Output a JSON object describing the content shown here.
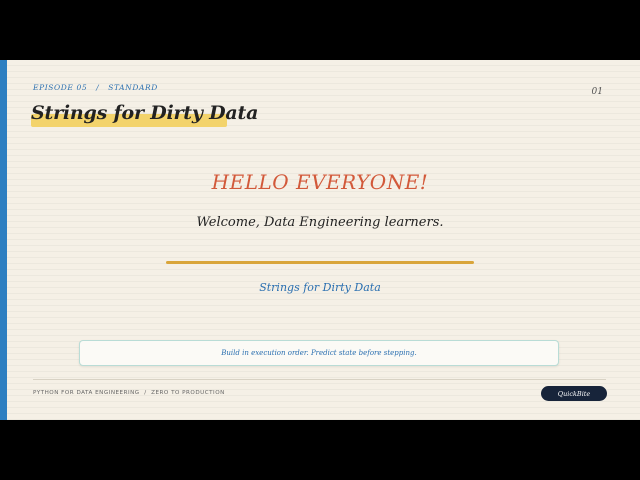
{
  "header": {
    "episode": "EPISODE 05",
    "separator": "/",
    "level": "STANDARD",
    "page_number": "01",
    "title": "Strings for Dirty Data"
  },
  "main": {
    "greeting": "HELLO EVERYONE!",
    "welcome": "Welcome, Data Engineering learners.",
    "subtitle": "Strings for Dirty Data",
    "note": "Build in execution order. Predict state before stepping."
  },
  "footer": {
    "course": "PYTHON FOR DATA ENGINEERING  /  ZERO TO PRODUCTION",
    "badge": "QuickBite"
  },
  "colors": {
    "accent_bar": "#2d7fc1",
    "title_highlight": "#f3d36b",
    "greeting": "#d2593a",
    "divider": "#d9a53a",
    "link_blue": "#2a6fb0",
    "badge_bg": "#17243a",
    "slide_bg": "#f5f0e6"
  }
}
